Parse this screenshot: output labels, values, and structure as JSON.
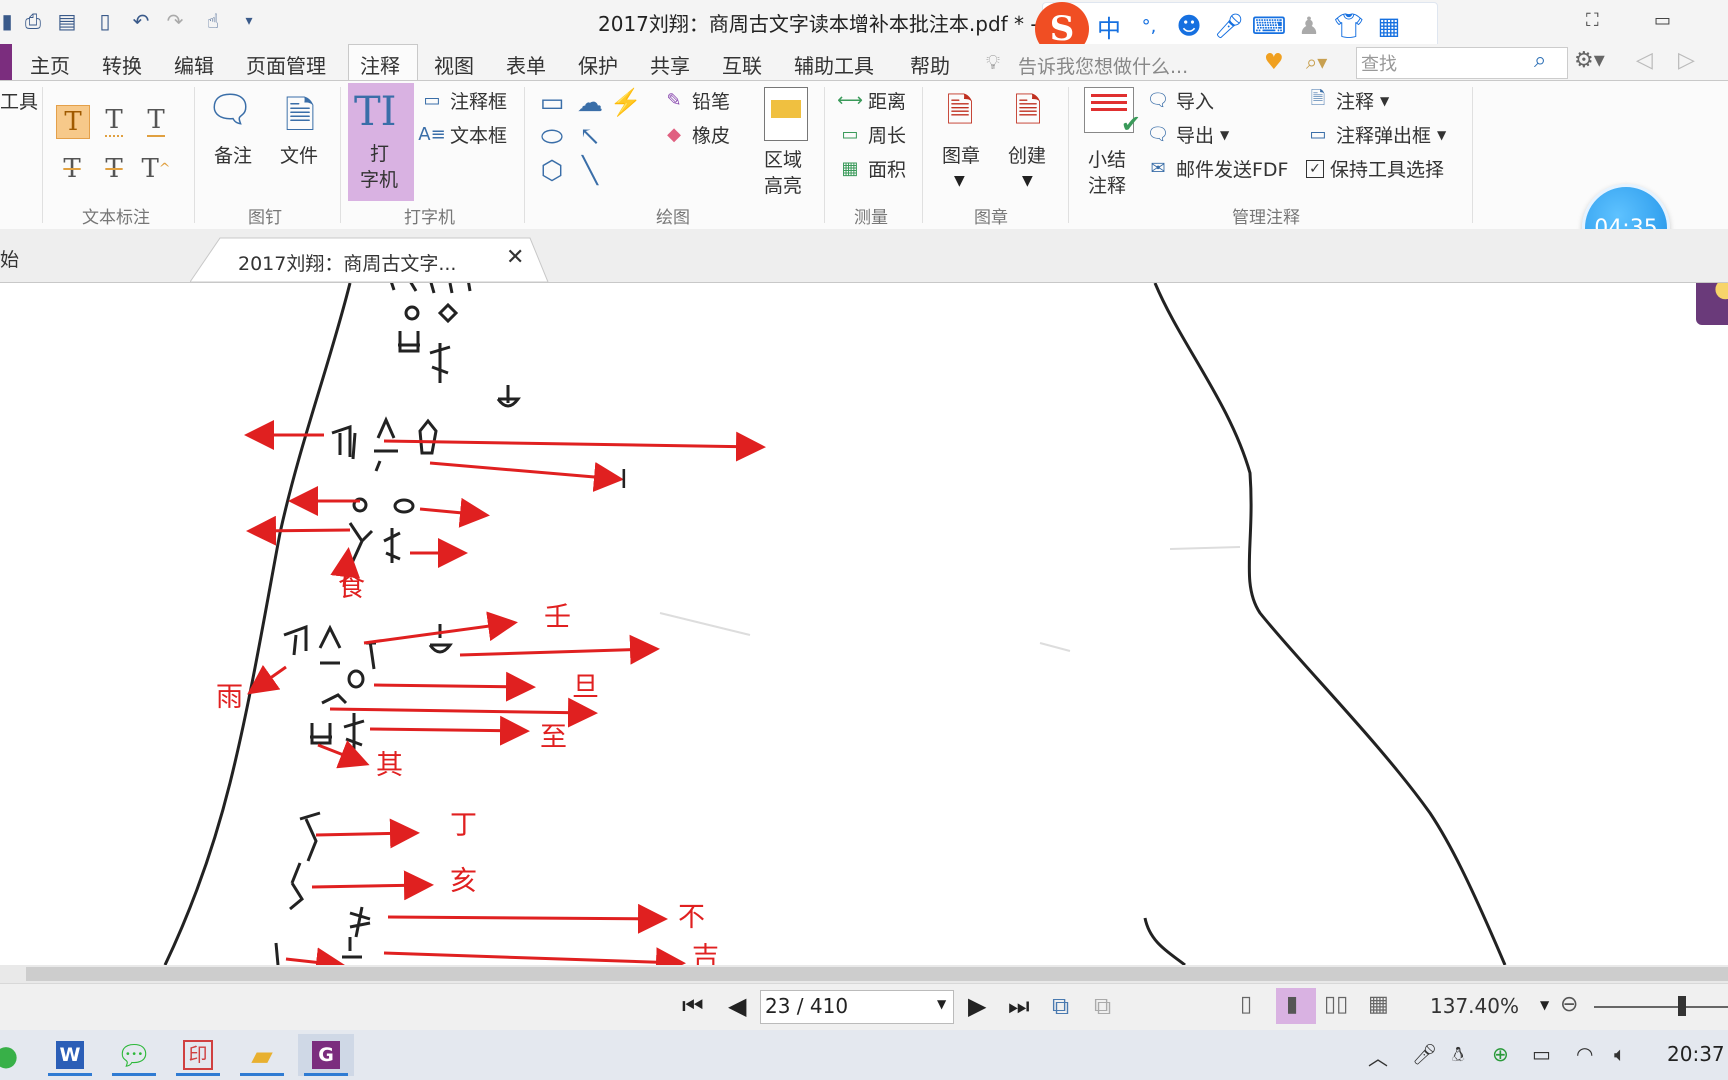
{
  "window": {
    "title": "2017刘翔：商周古文字读本增补本批注本.pdf * -",
    "ime": {
      "mode": "中",
      "punct": "°,",
      "icons": [
        "emoji-icon",
        "mic-icon",
        "keyboard-icon",
        "user-icon",
        "skin-icon",
        "apps-icon"
      ]
    }
  },
  "menu": {
    "items": [
      "主页",
      "转换",
      "编辑",
      "页面管理",
      "注释",
      "视图",
      "表单",
      "保护",
      "共享",
      "互联",
      "辅助工具",
      "帮助"
    ],
    "active": "注释",
    "tell_me": "告诉我您想做什么...",
    "search_placeholder": "查找"
  },
  "ribbon": {
    "left_partial": "工具",
    "groups": {
      "text_markup": "文本标注",
      "pin": "图钉",
      "typewriter": "打字机",
      "drawing": "绘图",
      "measure": "测量",
      "stamp": "图章",
      "manage": "管理注释"
    },
    "buttons": {
      "note": "备注",
      "file": "文件",
      "typewriter_line1": "打",
      "typewriter_line2": "字机",
      "callout": "注释框",
      "textbox": "文本框",
      "pencil": "铅笔",
      "eraser": "橡皮",
      "area_highlight_1": "区域",
      "area_highlight_2": "高亮",
      "distance": "距离",
      "perimeter": "周长",
      "area": "面积",
      "stamp": "图章",
      "create": "创建",
      "summary_1": "小结",
      "summary_2": "注释",
      "import": "导入",
      "export": "导出",
      "email_fdf": "邮件发送FDF",
      "comments": "注释",
      "popup": "注释弹出框",
      "keep_tool": "保持工具选择"
    },
    "timer": "04:35"
  },
  "tabs": {
    "start_partial": "始",
    "doc_tab": "2017刘翔：商周古文字..."
  },
  "annotations": [
    "食",
    "壬",
    "雨",
    "旦",
    "至",
    "其",
    "丁",
    "亥",
    "不",
    "吉"
  ],
  "status": {
    "page": "23 / 410",
    "zoom": "137.40%"
  },
  "taskbar": {
    "clock": "20:37",
    "apps": [
      "wechat-app",
      "word-app",
      "wechat-chat-app",
      "seal-app",
      "explorer-app",
      "pdf-app"
    ]
  }
}
